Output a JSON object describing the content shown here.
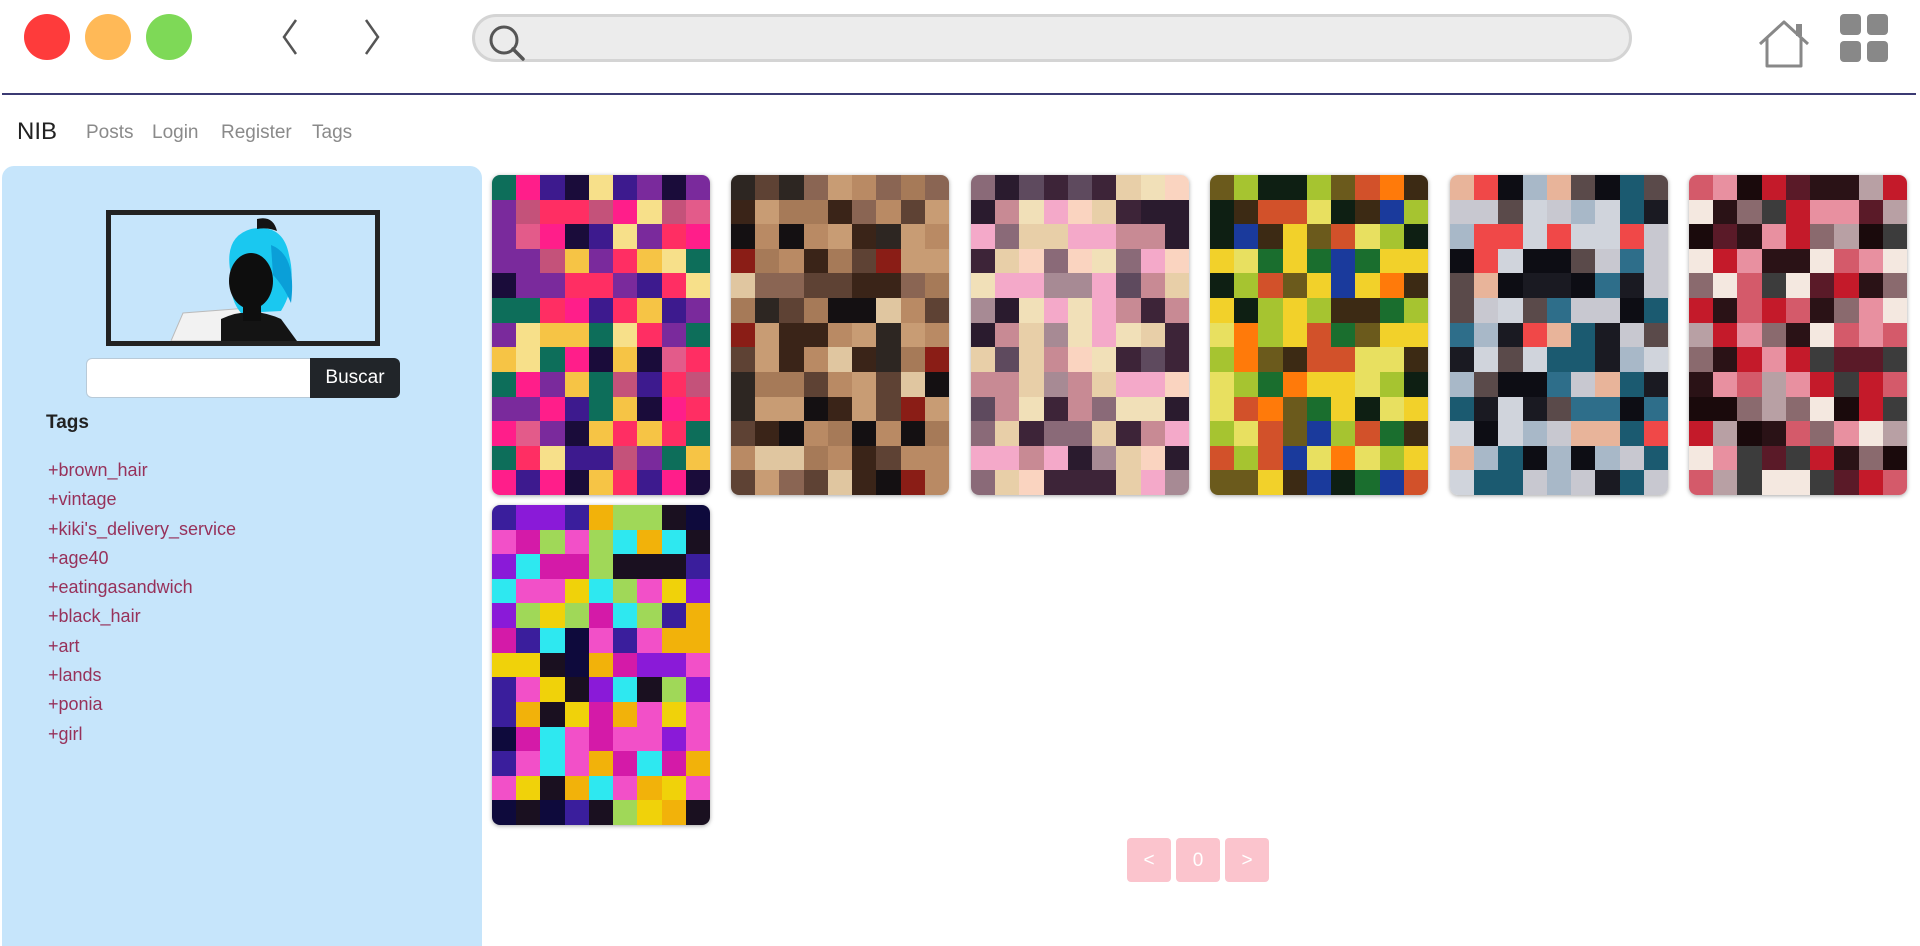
{
  "browser": {
    "address_value": "",
    "icons": [
      "close-light",
      "minimize-light",
      "maximize-light",
      "back-arrow",
      "forward-arrow",
      "search-icon",
      "home-icon",
      "apps-grid-icon"
    ]
  },
  "navbar": {
    "brand": "NIB",
    "links": [
      "Posts",
      "Login",
      "Register",
      "Tags"
    ]
  },
  "sidebar": {
    "search_value": "",
    "search_button": "Buscar",
    "tags_heading": "Tags",
    "tags": [
      "+brown_hair",
      "+vintage",
      "+kiki's_delivery_service",
      "+age40",
      "+eatingasandwich",
      "+black_hair",
      "+art",
      "+lands",
      "+ponia",
      "+girl"
    ]
  },
  "gallery": {
    "thumbnails": [
      {
        "palette": [
          "#ff2e63",
          "#f6c445",
          "#3d1a8e",
          "#c4527a",
          "#0d6e5a",
          "#f7e08a",
          "#ff1e8a",
          "#7a2a9c",
          "#e35b8a",
          "#1a0c3a"
        ]
      },
      {
        "palette": [
          "#8a6553",
          "#3a2418",
          "#b98a64",
          "#141012",
          "#8a1d16",
          "#c89c74",
          "#5e4234",
          "#a67a58",
          "#e0c6a0",
          "#2d2622"
        ]
      },
      {
        "palette": [
          "#f4a9c9",
          "#3d2438",
          "#e8cfa8",
          "#8a6a78",
          "#fad4c0",
          "#5e4a5e",
          "#2a1b2e",
          "#c88a94",
          "#f1e0b8",
          "#a78a94"
        ]
      },
      {
        "palette": [
          "#1a6e2e",
          "#f2d12a",
          "#0e1f13",
          "#ff7a0a",
          "#3c2a14",
          "#a6c430",
          "#1a3a9c",
          "#d2512a",
          "#6b5a1c",
          "#e8e060"
        ]
      },
      {
        "palette": [
          "#1b5a70",
          "#0d0d14",
          "#e8b49a",
          "#c8c8d0",
          "#2e6e8a",
          "#f04848",
          "#5a4a4a",
          "#d0d4dc",
          "#1a1a22",
          "#a8b8c8"
        ]
      },
      {
        "palette": [
          "#1a0a0c",
          "#c41a2a",
          "#f4e8e0",
          "#5a1a28",
          "#8a6a6e",
          "#e890a0",
          "#2a1216",
          "#d45a6a",
          "#3c3c3c",
          "#b8a0a4"
        ]
      },
      {
        "palette": [
          "#f250c8",
          "#3a1e9c",
          "#2ee8f0",
          "#f2b20a",
          "#0e0a3c",
          "#8a1ad8",
          "#a0d858",
          "#f0d20a",
          "#d41aa8",
          "#1a1020"
        ]
      }
    ]
  },
  "pagination": {
    "prev": "<",
    "current": "0",
    "next": ">"
  }
}
